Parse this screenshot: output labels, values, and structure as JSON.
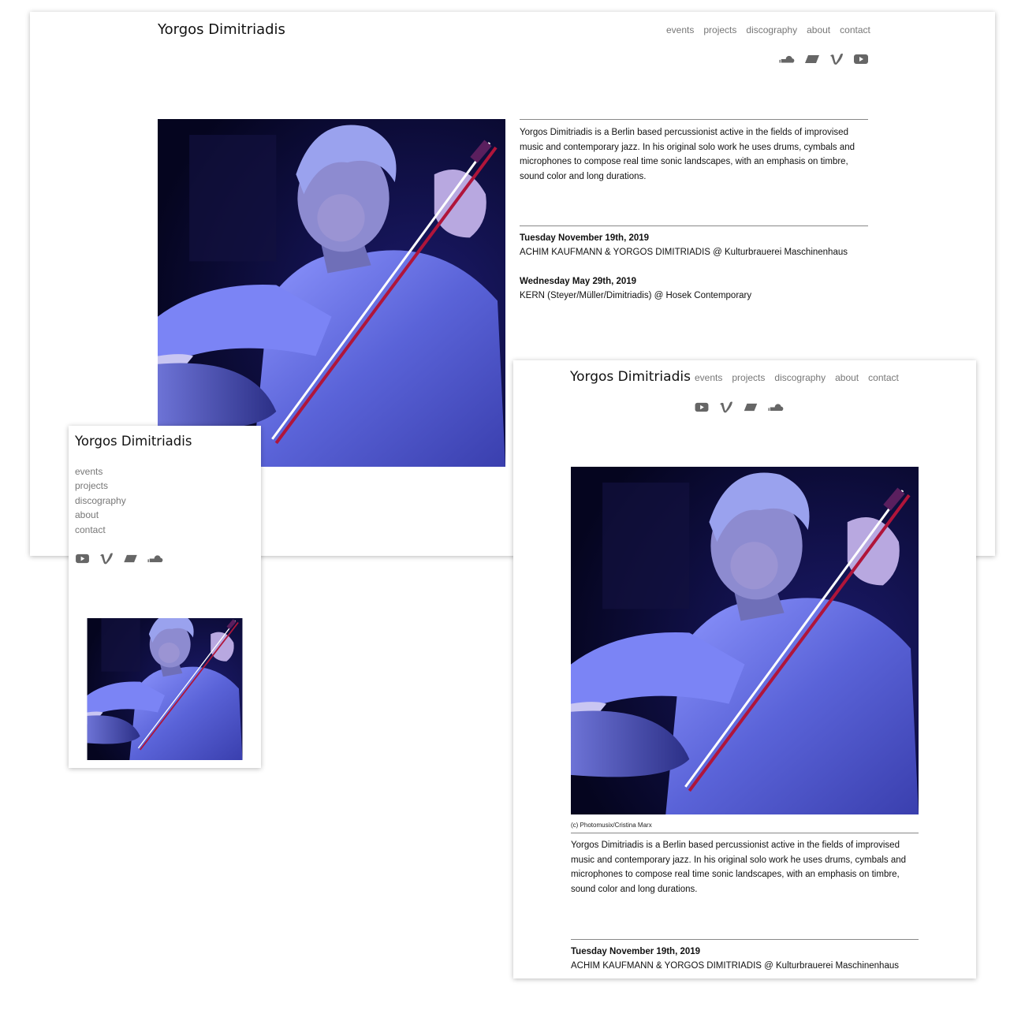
{
  "site": {
    "title": "Yorgos Dimitriadis",
    "nav": [
      "events",
      "projects",
      "discography",
      "about",
      "contact"
    ]
  },
  "social_icons": {
    "desktop": [
      "soundcloud-icon",
      "bandcamp-icon",
      "vimeo-icon",
      "youtube-icon"
    ],
    "tablet": [
      "youtube-icon",
      "vimeo-icon",
      "bandcamp-icon",
      "soundcloud-icon"
    ],
    "mobile": [
      "youtube-icon",
      "vimeo-icon",
      "bandcamp-icon",
      "soundcloud-icon"
    ]
  },
  "photo": {
    "caption": "(c) Photomusix/Cristina Marx"
  },
  "bio": "Yorgos Dimitriadis is a Berlin based percussionist active in the fields of improvised music and contemporary jazz. In his original solo work he uses drums, cymbals and microphones to compose real time sonic landscapes, with an emphasis on timbre, sound color and long durations.",
  "events": [
    {
      "date": "Tuesday November 19th, 2019",
      "desc": "ACHIM KAUFMANN & YORGOS DIMITRIADIS @ Kulturbrauerei Maschinenhaus"
    },
    {
      "date": "Wednesday May 29th, 2019",
      "desc": "KERN (Steyer/Müller/Dimitriadis) @ Hosek Contemporary"
    }
  ],
  "colors": {
    "nav_text": "#777777",
    "icon": "#666666",
    "rule": "#888888",
    "photo_background": "#0b0a3a",
    "photo_highlight": "#6a72e6"
  }
}
